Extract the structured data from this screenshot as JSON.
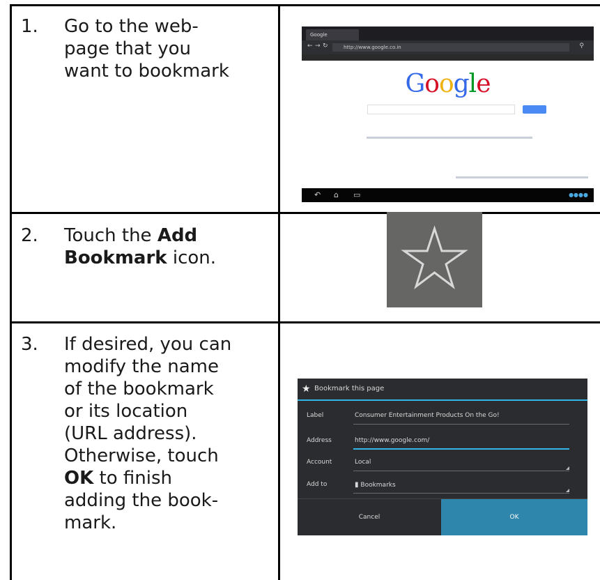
{
  "steps": [
    {
      "num": "1.",
      "line1": "Go to the web-",
      "line2": "page that you",
      "line3": "want to bookmark"
    },
    {
      "num": "2.",
      "pre": "Touch the ",
      "bold1": "Add",
      "bold2": "Bookmark",
      "post": " icon."
    },
    {
      "num": "3.",
      "l1": "If desired, you can",
      "l2": "modify the name",
      "l3": "of the bookmark",
      "l4": "or its location",
      "l5": "(URL address).",
      "l6": "Otherwise, touch",
      "bold": "OK",
      "l7post": " to finish",
      "l8": "adding the book-",
      "l9": "mark."
    }
  ],
  "browser": {
    "tab_label": "Google",
    "url": "http://www.google.co.in",
    "logo": "Google",
    "logo_colors": [
      "#3369e8",
      "#d50f25",
      "#eeb211",
      "#3369e8",
      "#009925",
      "#d50f25"
    ]
  },
  "star_icon": {
    "name": "star-outline-icon",
    "bg": "#666665",
    "stroke": "#d8d8d8"
  },
  "dialog": {
    "title": "Bookmark this page",
    "rows": [
      {
        "label": "Label",
        "value": "Consumer Entertainment Products On the Go!"
      },
      {
        "label": "Address",
        "value": "http://www.google.com/"
      },
      {
        "label": "Account",
        "value": "Local"
      },
      {
        "label": "Add to",
        "value": "Bookmarks"
      }
    ],
    "cancel": "Cancel",
    "ok": "OK",
    "accent": "#33b5e5"
  }
}
